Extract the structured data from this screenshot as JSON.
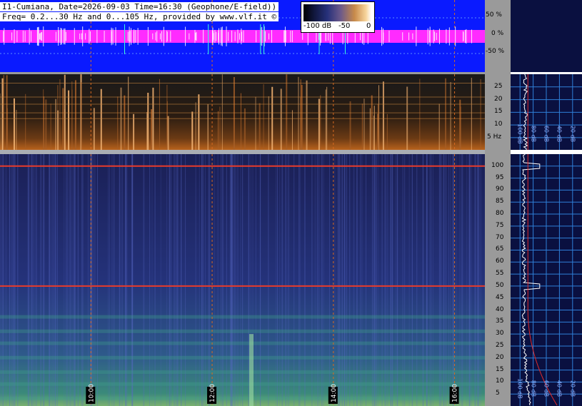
{
  "header": {
    "line1": "I1-Cumiana, Date=2026-09-03 Time=16:30 (Geophone/E-field))",
    "line2": "Freq= 0.2...30 Hz and 0...105 Hz, provided by www.vlf.it ©"
  },
  "colorbar": {
    "labels": [
      "-100 dB",
      "-50",
      "0"
    ]
  },
  "waveform_axis": {
    "ticks": [
      "50 %",
      "0 %",
      "-50 %"
    ]
  },
  "colors": {
    "wave_bg": "#0a1aff",
    "wave_trace": "#ff2bff",
    "spike": "#ffffff",
    "spec_high_bg": "#1c2257",
    "time_grid": "#d86a20",
    "freq_grid": "#3f8fd8",
    "hum_line": "#e83a2a",
    "side_bg": "#0a1040",
    "side_grid": "#2f7fd8",
    "side_trace": "#ffffff",
    "side_model": "#e02a2a"
  },
  "chart_data": [
    {
      "type": "heatmap",
      "title": "",
      "panel": "low-frequency spectrogram",
      "ylabel": "Hz",
      "ylim": [
        0.2,
        30
      ],
      "y_ticks": [
        "25",
        "20",
        "15",
        "10",
        "5 Hz"
      ],
      "y_tick_values": [
        25,
        20,
        15,
        10,
        5
      ],
      "time_ticks": [
        "10:00",
        "12:00",
        "14:00",
        "16:00"
      ],
      "time_tick_values_h": [
        10,
        12,
        14,
        16
      ],
      "time_range_h": [
        8.5,
        16.5
      ]
    },
    {
      "type": "heatmap",
      "title": "",
      "panel": "high-frequency spectrogram",
      "ylabel": "",
      "ylim": [
        0,
        105
      ],
      "y_ticks": [
        "100",
        "95",
        "90",
        "85",
        "80",
        "75",
        "70",
        "65",
        "60",
        "55",
        "50",
        "45",
        "40",
        "35",
        "30",
        "25",
        "20",
        "15",
        "10",
        "5"
      ],
      "y_tick_values": [
        100,
        95,
        90,
        85,
        80,
        75,
        70,
        65,
        60,
        55,
        50,
        45,
        40,
        35,
        30,
        25,
        20,
        15,
        10,
        5
      ],
      "time_ticks": [
        "10:00",
        "12:00",
        "14:00",
        "16:00"
      ],
      "time_tick_values_h": [
        10,
        12,
        14,
        16
      ],
      "time_range_h": [
        8.5,
        16.5
      ],
      "hum_lines_hz": [
        100,
        50
      ]
    },
    {
      "type": "line",
      "title": "",
      "panel": "average spectrum",
      "x_ticks": [
        "100 dB",
        "80 dB",
        "60 dB",
        "40 dB",
        "20 dB"
      ],
      "x_tick_values_db": [
        -100,
        -80,
        -60,
        -40,
        -20
      ],
      "xlim": [
        -110,
        -10
      ]
    }
  ]
}
